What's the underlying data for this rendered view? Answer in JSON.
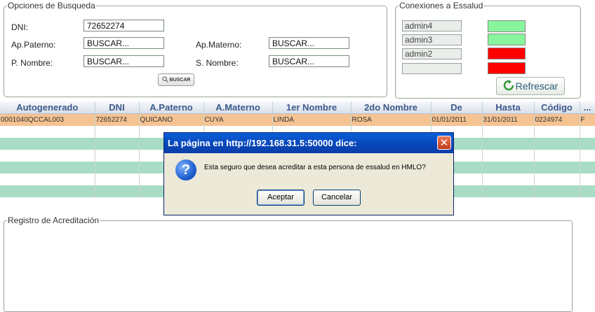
{
  "search": {
    "legend": "Opciones de Busqueda",
    "dni_label": "DNI:",
    "dni_value": "72652274",
    "ap_paterno_label": "Ap.Paterno:",
    "ap_paterno_value": "BUSCAR...",
    "ap_materno_label": "Ap.Materno:",
    "ap_materno_value": "BUSCAR...",
    "p_nombre_label": "P. Nombre:",
    "p_nombre_value": "BUSCAR...",
    "s_nombre_label": "S. Nombre:",
    "s_nombre_value": "BUSCAR...",
    "buscar_button": "BUSCAR",
    "buscar_icon": "magnifier-icon"
  },
  "connections": {
    "legend": "Conexiones a Essalud",
    "items": [
      {
        "name": "admin4",
        "status_color": "#88f59c"
      },
      {
        "name": "admin3",
        "status_color": "#88f59c"
      },
      {
        "name": "admin2",
        "status_color": "#ff0000"
      },
      {
        "name": "",
        "status_color": "#ff0000"
      }
    ],
    "refresh_button": "Refrescar",
    "refresh_icon": "refresh-icon"
  },
  "grid": {
    "columns": [
      "Autogenerado",
      "DNI",
      "A.Paterno",
      "A.Materno",
      "1er Nombre",
      "2do Nombre",
      "De",
      "Hasta",
      "Código",
      "..."
    ],
    "rows": [
      [
        "0001040QCCAL003",
        "72652274",
        "QUICANO",
        "CUYA",
        "LINDA",
        "ROSA",
        "01/01/2011",
        "31/01/2011",
        "0224974",
        "F"
      ]
    ],
    "colors": {
      "selected_row": "#f5c392",
      "alt_row": "#a9dcc4",
      "header_text": "#3d5a8a"
    }
  },
  "registro": {
    "legend": "Registro de Acreditación"
  },
  "dialog": {
    "title": "La página en http://192.168.31.5:50000 dice:",
    "message": "Esta seguro que desea acreditar a esta persona de essalud en HMLO?",
    "icon": "question-icon",
    "ok_button": "Aceptar",
    "cancel_button": "Cancelar",
    "close_glyph": "✕"
  }
}
